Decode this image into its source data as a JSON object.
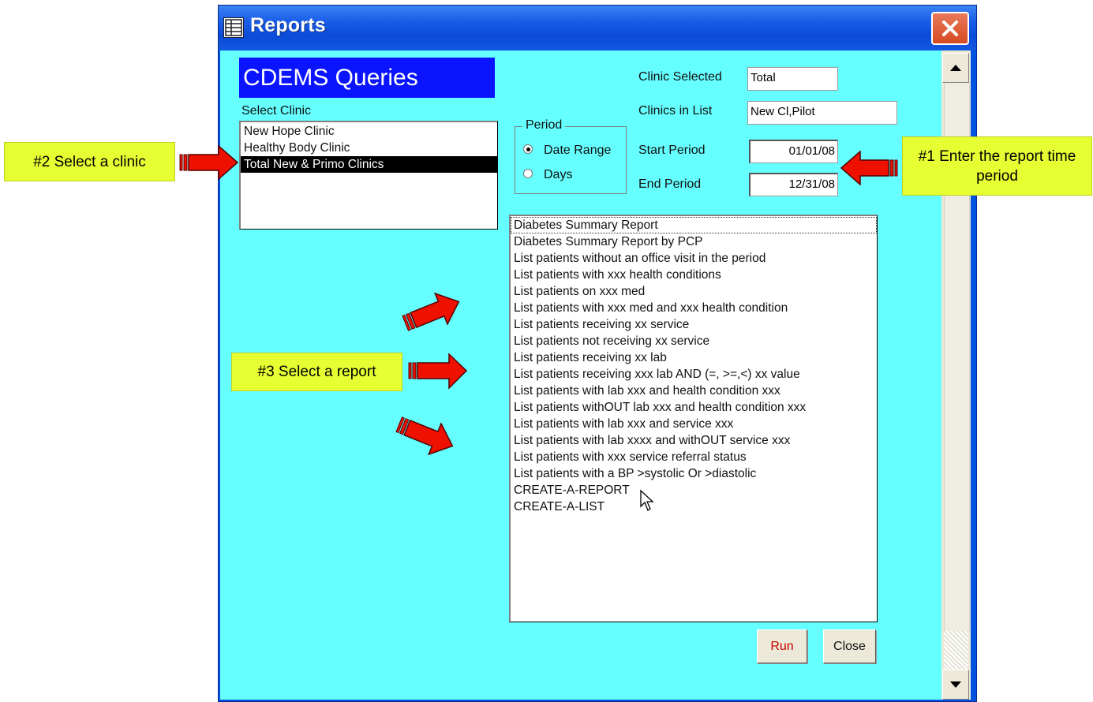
{
  "window": {
    "title": "Reports",
    "icon": "report-grid-icon"
  },
  "header": {
    "title": "CDEMS Queries"
  },
  "clinic_panel": {
    "label": "Select Clinic",
    "items": [
      {
        "label": "New Hope Clinic",
        "selected": false
      },
      {
        "label": "Healthy Body Clinic",
        "selected": false
      },
      {
        "label": "Total New & Primo Clinics",
        "selected": true
      }
    ]
  },
  "fields": {
    "clinic_selected_label": "Clinic Selected",
    "clinic_selected_value": "Total",
    "clinics_in_list_label": "Clinics in List",
    "clinics_in_list_value": "New Cl,Pilot",
    "start_period_label": "Start Period",
    "start_period_value": "01/01/08",
    "end_period_label": "End Period",
    "end_period_value": "12/31/08"
  },
  "period": {
    "legend": "Period",
    "options": [
      {
        "label": "Date Range",
        "checked": true
      },
      {
        "label": "Days",
        "checked": false
      }
    ]
  },
  "reports": [
    "Diabetes Summary Report",
    "Diabetes Summary Report by PCP",
    "List patients without an office visit in the period",
    "List patients with xxx health conditions",
    "List patients on xxx med",
    "List patients with xxx med and  xxx health condition",
    "List patients receiving xx service",
    "List patients not receiving xx service",
    "List patients receiving xx lab",
    "List patients receiving xxx lab AND (=, >=,<) xx value",
    "List patients with lab xxx and health condition xxx",
    "List patients withOUT lab xxx and  health condition xxx",
    "List patients with lab xxx and service xxx",
    "List patients with lab xxxx and withOUT service xxx",
    "List patients with xxx service referral status",
    "List patients with a  BP >systolic Or >diastolic",
    "CREATE-A-REPORT",
    "CREATE-A-LIST"
  ],
  "buttons": {
    "run": "Run",
    "close": "Close"
  },
  "callouts": {
    "step1": "#1  Enter the report time period",
    "step2": "#2  Select a clinic",
    "step3": "#3  Select a report"
  },
  "colors": {
    "client_bg": "#66ffff",
    "header_bg": "#0a14ff",
    "callout_bg": "#e6ff33",
    "arrow": "#ee1100",
    "run_text": "#cc0000"
  }
}
